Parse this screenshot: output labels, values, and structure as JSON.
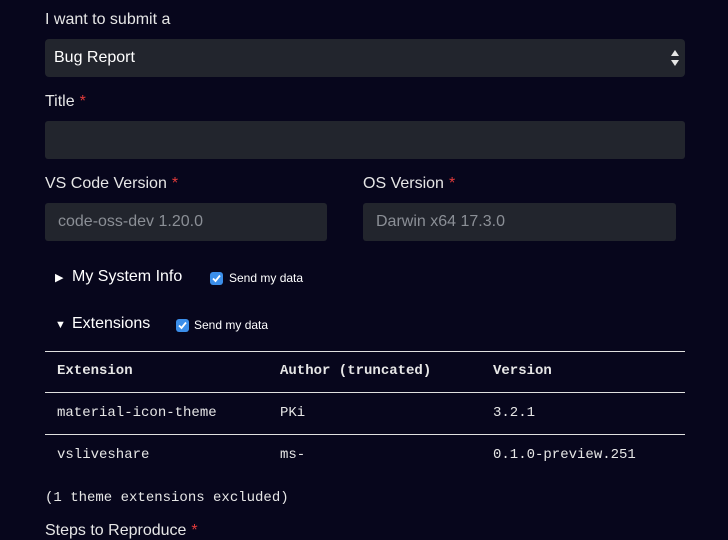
{
  "submit_label": "I want to submit a",
  "issue_type": {
    "selected": "Bug Report"
  },
  "title": {
    "label": "Title",
    "required_mark": "*",
    "value": ""
  },
  "vscode_version": {
    "label": "VS Code Version",
    "required_mark": "*",
    "value": "code-oss-dev 1.20.0"
  },
  "os_version": {
    "label": "OS Version",
    "required_mark": "*",
    "value": "Darwin x64 17.3.0"
  },
  "system_info": {
    "label": "My System Info",
    "collapsed_glyph": "▶",
    "send_label": "Send my data",
    "send_checked": true
  },
  "extensions": {
    "label": "Extensions",
    "expanded_glyph": "▼",
    "send_label": "Send my data",
    "send_checked": true,
    "columns": [
      "Extension",
      "Author (truncated)",
      "Version"
    ],
    "rows": [
      [
        "material-icon-theme",
        "PKi",
        "3.2.1"
      ],
      [
        "vsliveshare",
        "ms-",
        "0.1.0-preview.251"
      ]
    ],
    "footnote": "(1 theme extensions excluded)"
  },
  "steps": {
    "label": "Steps to Reproduce",
    "required_mark": "*"
  },
  "colors": {
    "background": "#07061c",
    "field": "#22252d",
    "required": "#e23b3b",
    "checkbox": "#3b8eea"
  }
}
